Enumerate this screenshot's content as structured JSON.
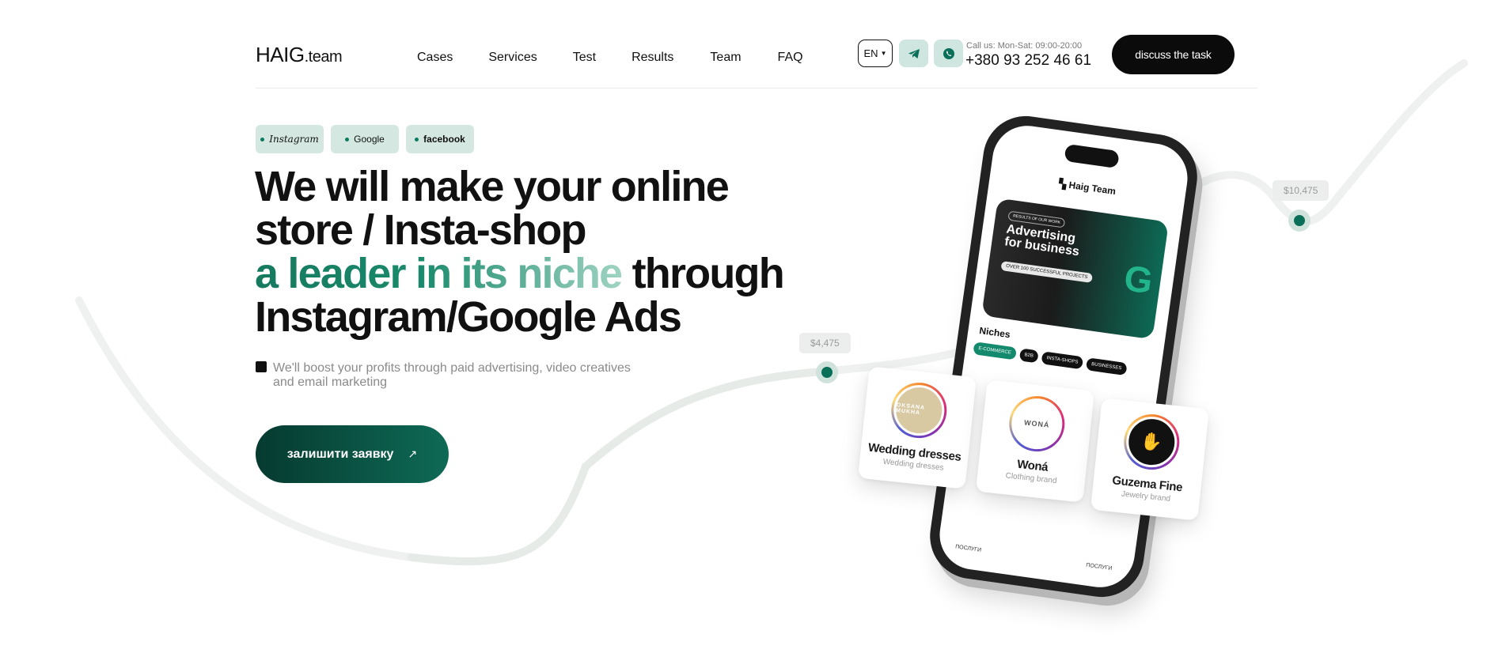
{
  "header": {
    "logo_main": "HAIG",
    "logo_suffix": ".team",
    "nav": [
      "Cases",
      "Services",
      "Test",
      "Results",
      "Team",
      "FAQ"
    ],
    "lang": "EN",
    "call_label": "Call us: Mon-Sat: 09:00-20:00",
    "phone": "+380 93 252 46 61",
    "cta": "discuss the task"
  },
  "hero": {
    "tags": [
      "Instagram",
      "Google",
      "facebook"
    ],
    "headline_line1": "We will make your online",
    "headline_line2": "store / Insta-shop",
    "headline_green": "a leader in its niche",
    "headline_through": " through",
    "headline_line4": "Instagram/Google Ads",
    "subtitle_line1": "We'll boost your profits through paid advertising, video creatives",
    "subtitle_line2": "and email marketing",
    "cta": "залишити заявку",
    "cta_icon": "arrow-up-right-icon"
  },
  "graph": {
    "price_1": "$4,475",
    "price_2": "$10,475"
  },
  "phone_screen": {
    "brand": "Haig Team",
    "ad_pill": "RESULTS OF OUR WORK",
    "ad_title_1": "Advertising",
    "ad_title_2": "for business",
    "ad_sub": "OVER 100 SUCCESSFUL PROJECTS",
    "ad_letter": "G",
    "niches_title": "Niches",
    "niches": [
      "E-COMMERCE",
      "B2B",
      "INSTA-SHOPS",
      "BUSINESSES"
    ],
    "footer_left": "ПОСЛУГИ",
    "footer_right": "ПОСЛУГИ"
  },
  "cards": [
    {
      "title": "Wedding dresses",
      "subtitle": "Wedding dresses",
      "logo": "OKSANA MUKHA"
    },
    {
      "title": "Woná",
      "subtitle": "Clothing brand",
      "logo": "WONÁ"
    },
    {
      "title": "Guzema Fine",
      "subtitle": "Jewelry brand",
      "logo": ""
    }
  ],
  "colors": {
    "accent": "#0a6f58",
    "tag_bg": "#d4e8e1",
    "dark": "#0b0b0b"
  }
}
